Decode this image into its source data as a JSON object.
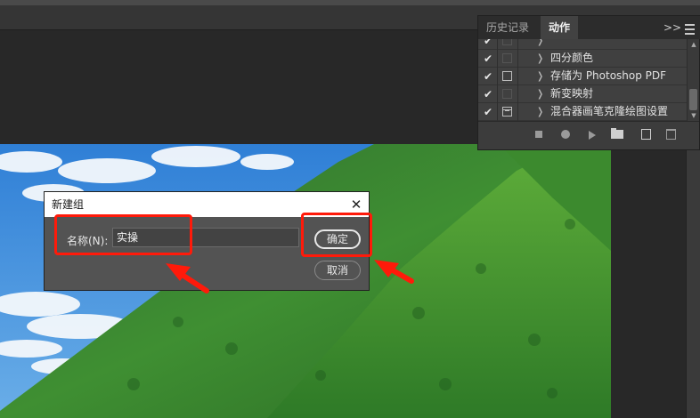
{
  "panel": {
    "tabs": [
      "历史记录",
      "动作"
    ],
    "expand_glyph": ">>",
    "rows": [
      {
        "label": "",
        "checked": true
      },
      {
        "label": "四分颜色",
        "checked": true
      },
      {
        "label": "存储为 Photoshop PDF",
        "checked": true
      },
      {
        "label": "新变映射",
        "checked": true
      },
      {
        "label": "混合器画笔克隆绘图设置",
        "checked": true
      }
    ],
    "check_glyph": "✔",
    "chevron_glyph": "❭"
  },
  "dialog": {
    "title": "新建组",
    "close_glyph": "✕",
    "name_label": "名称(N):",
    "name_value": "实操",
    "ok_label": "确定",
    "cancel_label": "取消"
  },
  "annotation": {
    "highlight_color": "#ff1a0a"
  }
}
